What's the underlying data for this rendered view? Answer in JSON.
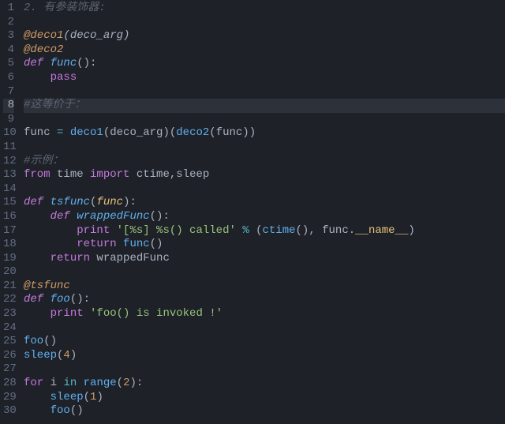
{
  "code": {
    "lines": [
      {
        "n": 1,
        "tokens": [
          [
            "c",
            "2. 有参装饰器:"
          ]
        ]
      },
      {
        "n": 2,
        "tokens": []
      },
      {
        "n": 3,
        "tokens": [
          [
            "dec",
            "@deco1"
          ],
          [
            "pli",
            "("
          ],
          [
            "pli",
            "deco_arg"
          ],
          [
            "pli",
            ")"
          ]
        ]
      },
      {
        "n": 4,
        "tokens": [
          [
            "dec",
            "@deco2"
          ]
        ]
      },
      {
        "n": 5,
        "tokens": [
          [
            "kw",
            "def"
          ],
          [
            "pl",
            " "
          ],
          [
            "fni",
            "func"
          ],
          [
            "pl",
            "():"
          ]
        ]
      },
      {
        "n": 6,
        "tokens": [
          [
            "pl",
            "    "
          ],
          [
            "kwn",
            "pass"
          ]
        ]
      },
      {
        "n": 7,
        "tokens": []
      },
      {
        "n": 8,
        "hl": true,
        "tokens": [
          [
            "c",
            "#这等价于："
          ]
        ]
      },
      {
        "n": 9,
        "tokens": []
      },
      {
        "n": 10,
        "tokens": [
          [
            "pl",
            "func "
          ],
          [
            "op",
            "="
          ],
          [
            "pl",
            " "
          ],
          [
            "fn",
            "deco1"
          ],
          [
            "pl",
            "(deco_arg)("
          ],
          [
            "fn",
            "deco2"
          ],
          [
            "pl",
            "(func))"
          ]
        ]
      },
      {
        "n": 11,
        "tokens": []
      },
      {
        "n": 12,
        "tokens": [
          [
            "c",
            "#示例："
          ]
        ]
      },
      {
        "n": 13,
        "tokens": [
          [
            "kwn",
            "from"
          ],
          [
            "pl",
            " time "
          ],
          [
            "kwn",
            "import"
          ],
          [
            "pl",
            " ctime,sleep"
          ]
        ]
      },
      {
        "n": 14,
        "tokens": []
      },
      {
        "n": 15,
        "tokens": [
          [
            "kw",
            "def"
          ],
          [
            "pl",
            " "
          ],
          [
            "fni",
            "tsfunc"
          ],
          [
            "pl",
            "("
          ],
          [
            "prmi",
            "func"
          ],
          [
            "pl",
            "):"
          ]
        ]
      },
      {
        "n": 16,
        "tokens": [
          [
            "pl",
            "    "
          ],
          [
            "kw",
            "def"
          ],
          [
            "pl",
            " "
          ],
          [
            "fni",
            "wrappedFunc"
          ],
          [
            "pl",
            "():"
          ]
        ]
      },
      {
        "n": 17,
        "tokens": [
          [
            "pl",
            "        "
          ],
          [
            "kwn",
            "print"
          ],
          [
            "pl",
            " "
          ],
          [
            "str",
            "'[%s] %s() called'"
          ],
          [
            "pl",
            " "
          ],
          [
            "op",
            "%"
          ],
          [
            "pl",
            " ("
          ],
          [
            "fn",
            "ctime"
          ],
          [
            "pl",
            "(), func."
          ],
          [
            "spc",
            "__name__"
          ],
          [
            "pl",
            ")"
          ]
        ]
      },
      {
        "n": 18,
        "tokens": [
          [
            "pl",
            "        "
          ],
          [
            "kwn",
            "return"
          ],
          [
            "pl",
            " "
          ],
          [
            "fn",
            "func"
          ],
          [
            "pl",
            "()"
          ]
        ]
      },
      {
        "n": 19,
        "tokens": [
          [
            "pl",
            "    "
          ],
          [
            "kwn",
            "return"
          ],
          [
            "pl",
            " wrappedFunc"
          ]
        ]
      },
      {
        "n": 20,
        "tokens": []
      },
      {
        "n": 21,
        "tokens": [
          [
            "dec",
            "@tsfunc"
          ]
        ]
      },
      {
        "n": 22,
        "tokens": [
          [
            "kw",
            "def"
          ],
          [
            "pl",
            " "
          ],
          [
            "fni",
            "foo"
          ],
          [
            "pl",
            "():"
          ]
        ]
      },
      {
        "n": 23,
        "tokens": [
          [
            "pl",
            "    "
          ],
          [
            "kwn",
            "print"
          ],
          [
            "pl",
            " "
          ],
          [
            "str",
            "'foo() is invoked !'"
          ]
        ]
      },
      {
        "n": 24,
        "tokens": []
      },
      {
        "n": 25,
        "tokens": [
          [
            "fn",
            "foo"
          ],
          [
            "pl",
            "()"
          ]
        ]
      },
      {
        "n": 26,
        "tokens": [
          [
            "fn",
            "sleep"
          ],
          [
            "pl",
            "("
          ],
          [
            "num",
            "4"
          ],
          [
            "pl",
            ")"
          ]
        ]
      },
      {
        "n": 27,
        "tokens": []
      },
      {
        "n": 28,
        "tokens": [
          [
            "kwn",
            "for"
          ],
          [
            "pl",
            " i "
          ],
          [
            "op",
            "in"
          ],
          [
            "pl",
            " "
          ],
          [
            "fn",
            "range"
          ],
          [
            "pl",
            "("
          ],
          [
            "num",
            "2"
          ],
          [
            "pl",
            "):"
          ]
        ]
      },
      {
        "n": 29,
        "tokens": [
          [
            "pl",
            "    "
          ],
          [
            "fn",
            "sleep"
          ],
          [
            "pl",
            "("
          ],
          [
            "num",
            "1"
          ],
          [
            "pl",
            ")"
          ]
        ]
      },
      {
        "n": 30,
        "tokens": [
          [
            "pl",
            "    "
          ],
          [
            "fn",
            "foo"
          ],
          [
            "pl",
            "()"
          ]
        ]
      }
    ]
  }
}
